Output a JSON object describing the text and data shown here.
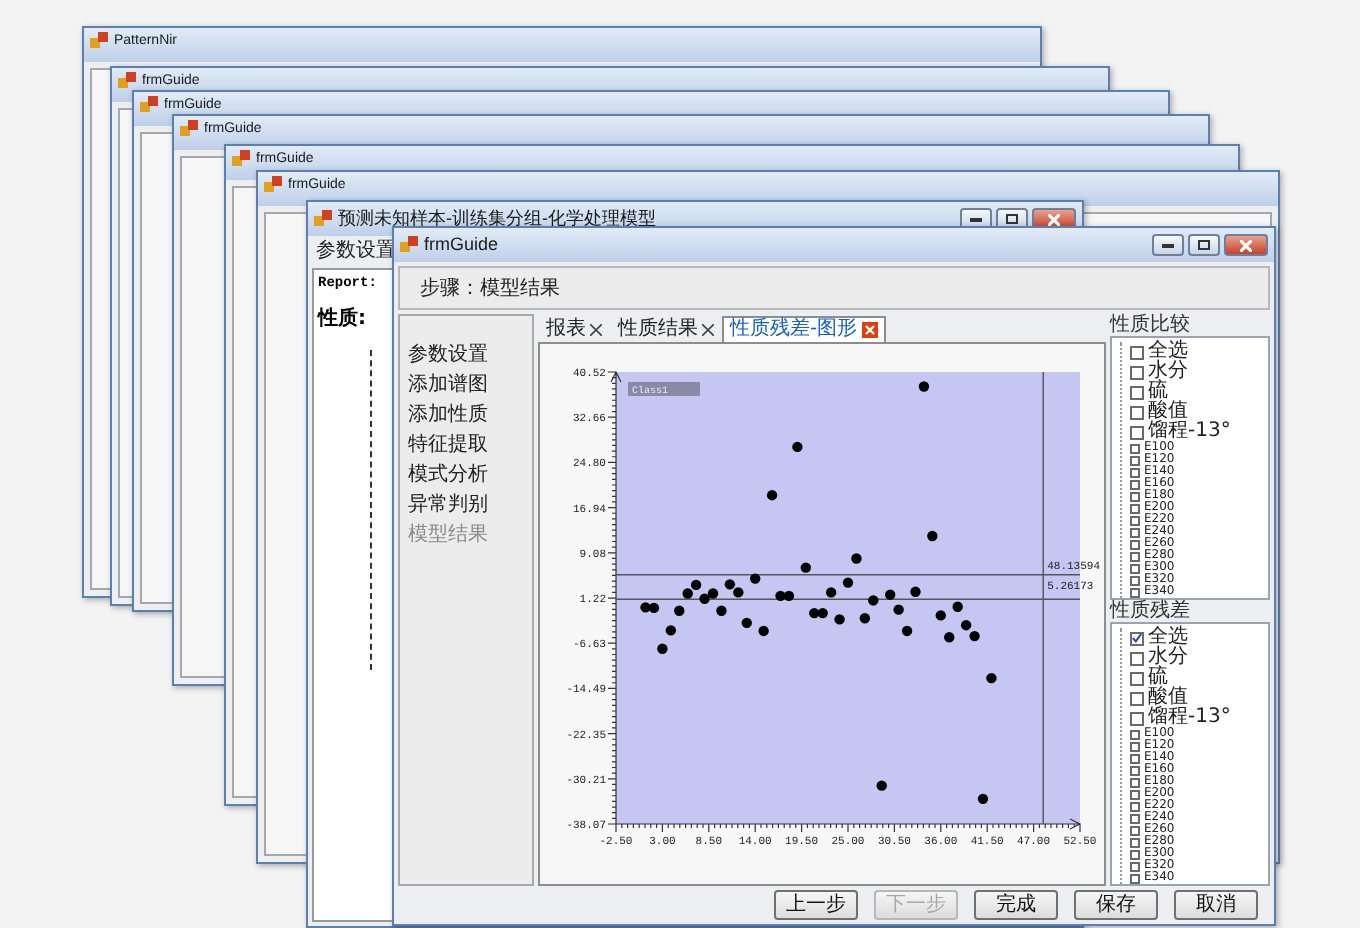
{
  "desktop_windows": [
    {
      "title": "PatternNir"
    },
    {
      "title": "frmGuide"
    },
    {
      "title": "frmGuide"
    },
    {
      "title": "frmGuide"
    },
    {
      "title": "frmGuide"
    },
    {
      "title": "frmGuide"
    }
  ],
  "report_window": {
    "title": "预测未知样本-训练集分组-化学处理模型",
    "tab": "参数设置",
    "labels": [
      "Report:",
      "性质:"
    ]
  },
  "guide_window": {
    "title": "frmGuide",
    "step": "步骤：模型结果",
    "steps": [
      {
        "label": "参数设置",
        "selected": false
      },
      {
        "label": "添加谱图",
        "selected": false
      },
      {
        "label": "添加性质",
        "selected": false
      },
      {
        "label": "特征提取",
        "selected": false
      },
      {
        "label": "模式分析",
        "selected": false
      },
      {
        "label": "异常判别",
        "selected": false
      },
      {
        "label": "模型结果",
        "selected": true
      }
    ],
    "tabs": [
      {
        "label": "报表",
        "selected": false
      },
      {
        "label": "性质结果",
        "selected": false
      },
      {
        "label": "性质残差-图形",
        "selected": true
      }
    ],
    "chart_data": {
      "type": "scatter",
      "x": [
        1,
        2,
        3,
        4,
        5,
        6,
        7,
        8,
        9,
        10,
        11,
        12,
        13,
        14,
        15,
        16,
        17,
        18,
        19,
        20,
        21,
        22,
        23,
        24,
        25,
        26,
        27,
        28,
        29,
        30,
        31,
        32,
        33,
        34,
        35,
        36,
        37,
        38,
        39,
        40,
        41,
        42
      ],
      "series": [
        {
          "name": "Class1",
          "color": "#000000",
          "values": [
            -0.4,
            -0.5,
            -7.6,
            -4.4,
            -1.0,
            2.0,
            3.5,
            1.1,
            2.0,
            -1.0,
            3.6,
            2.2,
            -3.1,
            4.6,
            -4.5,
            19.1,
            1.6,
            1.6,
            27.5,
            6.5,
            -1.4,
            -1.4,
            2.2,
            -2.5,
            3.9,
            8.1,
            -2.3,
            0.8,
            -31.4,
            1.8,
            -0.8,
            -4.5,
            2.3,
            38.0,
            12.0,
            -1.8,
            -5.6,
            -0.3,
            -3.5,
            -5.4,
            -33.7,
            -12.7
          ]
        }
      ],
      "xlim": [
        -2.5,
        52.5
      ],
      "ylim": [
        -38.07,
        40.52
      ],
      "xticks": [
        {
          "value": -2.5,
          "label": "-2.50"
        },
        {
          "value": 3,
          "label": "3.00"
        },
        {
          "value": 8.5,
          "label": "8.50"
        },
        {
          "value": 14,
          "label": "14.00"
        },
        {
          "value": 19.5,
          "label": "19.50"
        },
        {
          "value": 25,
          "label": "25.00"
        },
        {
          "value": 30.5,
          "label": "30.50"
        },
        {
          "value": 36,
          "label": "36.00"
        },
        {
          "value": 41.5,
          "label": "41.50"
        },
        {
          "value": 47,
          "label": "47.00"
        },
        {
          "value": 52.5,
          "label": "52.50"
        }
      ],
      "yticks": [
        {
          "value": 40.52,
          "label": "40.52"
        },
        {
          "value": 32.66,
          "label": "32.66"
        },
        {
          "value": 24.8,
          "label": "24.80"
        },
        {
          "value": 16.94,
          "label": "16.94"
        },
        {
          "value": 9.08,
          "label": "9.08"
        },
        {
          "value": 1.22,
          "label": "1.22"
        },
        {
          "value": -6.63,
          "label": "-6.63"
        },
        {
          "value": -14.49,
          "label": "-14.49"
        },
        {
          "value": -22.35,
          "label": "-22.35"
        },
        {
          "value": -30.21,
          "label": "-30.21"
        },
        {
          "value": -38.07,
          "label": "-38.07"
        }
      ],
      "ref_lines": [
        {
          "axis": "y",
          "value": 1.0
        },
        {
          "axis": "y",
          "value": 5.26
        },
        {
          "axis": "x",
          "value": 48.14
        }
      ],
      "annotations": [
        {
          "x": 48.14,
          "y": 5.26,
          "text": "48.13594"
        },
        {
          "x": 48.14,
          "y": 5.26,
          "text": "5.26173"
        }
      ]
    },
    "property_groups": [
      {
        "title": "性质比较",
        "items": [
          {
            "label": "全选",
            "kind": "property",
            "checked": false
          },
          {
            "label": "水分",
            "kind": "property",
            "checked": false
          },
          {
            "label": "硫",
            "kind": "property",
            "checked": false
          },
          {
            "label": "酸值",
            "kind": "property",
            "checked": false
          },
          {
            "label": "馏程-13°",
            "kind": "property",
            "checked": false
          },
          {
            "label": "E100",
            "kind": "fraction",
            "checked": false
          },
          {
            "label": "E120",
            "kind": "fraction",
            "checked": false
          },
          {
            "label": "E140",
            "kind": "fraction",
            "checked": false
          },
          {
            "label": "E160",
            "kind": "fraction",
            "checked": false
          },
          {
            "label": "E180",
            "kind": "fraction",
            "checked": false
          },
          {
            "label": "E200",
            "kind": "fraction",
            "checked": false
          },
          {
            "label": "E220",
            "kind": "fraction",
            "checked": false
          },
          {
            "label": "E240",
            "kind": "fraction",
            "checked": false
          },
          {
            "label": "E260",
            "kind": "fraction",
            "checked": false
          },
          {
            "label": "E280",
            "kind": "fraction",
            "checked": false
          },
          {
            "label": "E300",
            "kind": "fraction",
            "checked": false
          },
          {
            "label": "E320",
            "kind": "fraction",
            "checked": false
          },
          {
            "label": "E340",
            "kind": "fraction",
            "checked": false
          }
        ]
      },
      {
        "title": "性质残差",
        "items": [
          {
            "label": "全选",
            "kind": "property",
            "checked": true
          },
          {
            "label": "水分",
            "kind": "property",
            "checked": false
          },
          {
            "label": "硫",
            "kind": "property",
            "checked": false
          },
          {
            "label": "酸值",
            "kind": "property",
            "checked": false
          },
          {
            "label": "馏程-13°",
            "kind": "property",
            "checked": false
          },
          {
            "label": "E100",
            "kind": "fraction",
            "checked": false
          },
          {
            "label": "E120",
            "kind": "fraction",
            "checked": false
          },
          {
            "label": "E140",
            "kind": "fraction",
            "checked": false
          },
          {
            "label": "E160",
            "kind": "fraction",
            "checked": false
          },
          {
            "label": "E180",
            "kind": "fraction",
            "checked": false
          },
          {
            "label": "E200",
            "kind": "fraction",
            "checked": false
          },
          {
            "label": "E220",
            "kind": "fraction",
            "checked": false
          },
          {
            "label": "E240",
            "kind": "fraction",
            "checked": false
          },
          {
            "label": "E260",
            "kind": "fraction",
            "checked": false
          },
          {
            "label": "E280",
            "kind": "fraction",
            "checked": false
          },
          {
            "label": "E300",
            "kind": "fraction",
            "checked": false
          },
          {
            "label": "E320",
            "kind": "fraction",
            "checked": false
          },
          {
            "label": "E340",
            "kind": "fraction",
            "checked": false
          }
        ]
      }
    ],
    "buttons": [
      {
        "label": "上一步",
        "disabled": false
      },
      {
        "label": "下一步",
        "disabled": true
      },
      {
        "label": "完成",
        "disabled": false
      },
      {
        "label": "保存",
        "disabled": false
      },
      {
        "label": "取消",
        "disabled": false
      }
    ]
  }
}
